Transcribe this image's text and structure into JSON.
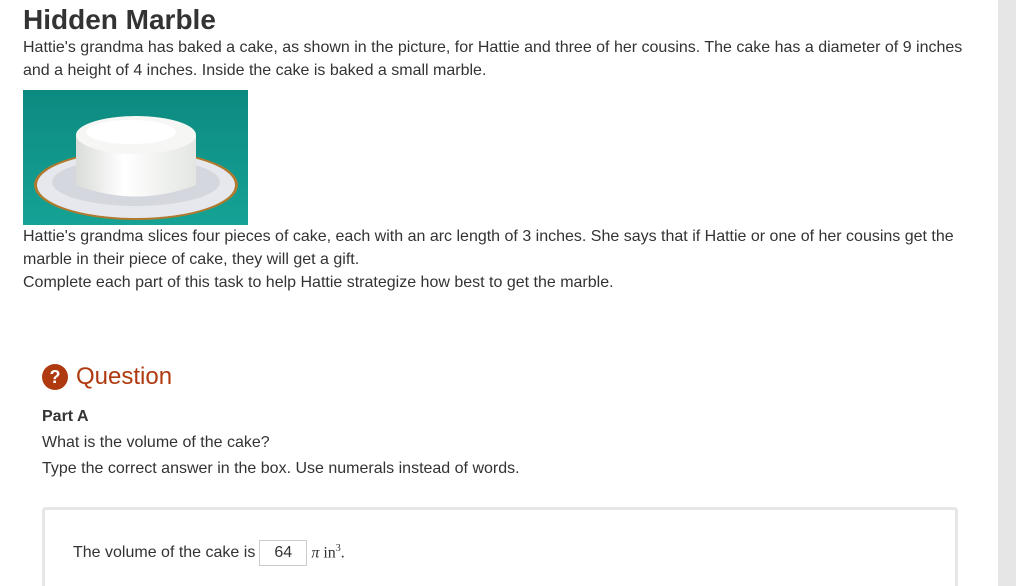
{
  "title": "Hidden Marble",
  "intro": "Hattie's grandma has baked a cake, as shown in the picture, for Hattie and three of her cousins. The cake has a diameter of 9 inches and a height of 4 inches. Inside the cake is baked a small marble.",
  "paragraph2": "Hattie's grandma slices four pieces of cake, each with an arc length of 3 inches. She says that if Hattie or one of her cousins get the marble in their piece of cake, they will get a gift.",
  "paragraph3": "Complete each part of this task to help Hattie strategize how best to get the marble.",
  "question": {
    "icon": "?",
    "title": "Question",
    "part": "Part A",
    "prompt": "What is the volume of the cake?",
    "instruction": "Type the correct answer in the box. Use numerals instead of words.",
    "answer_prefix": "The volume of the cake is",
    "answer_value": "64",
    "unit_pi": "π",
    "unit_in": "in",
    "unit_exp": "3",
    "unit_period": "."
  },
  "colors": {
    "accent": "#b03a10",
    "text": "#333333",
    "cake_bg": "#0f8f86"
  }
}
